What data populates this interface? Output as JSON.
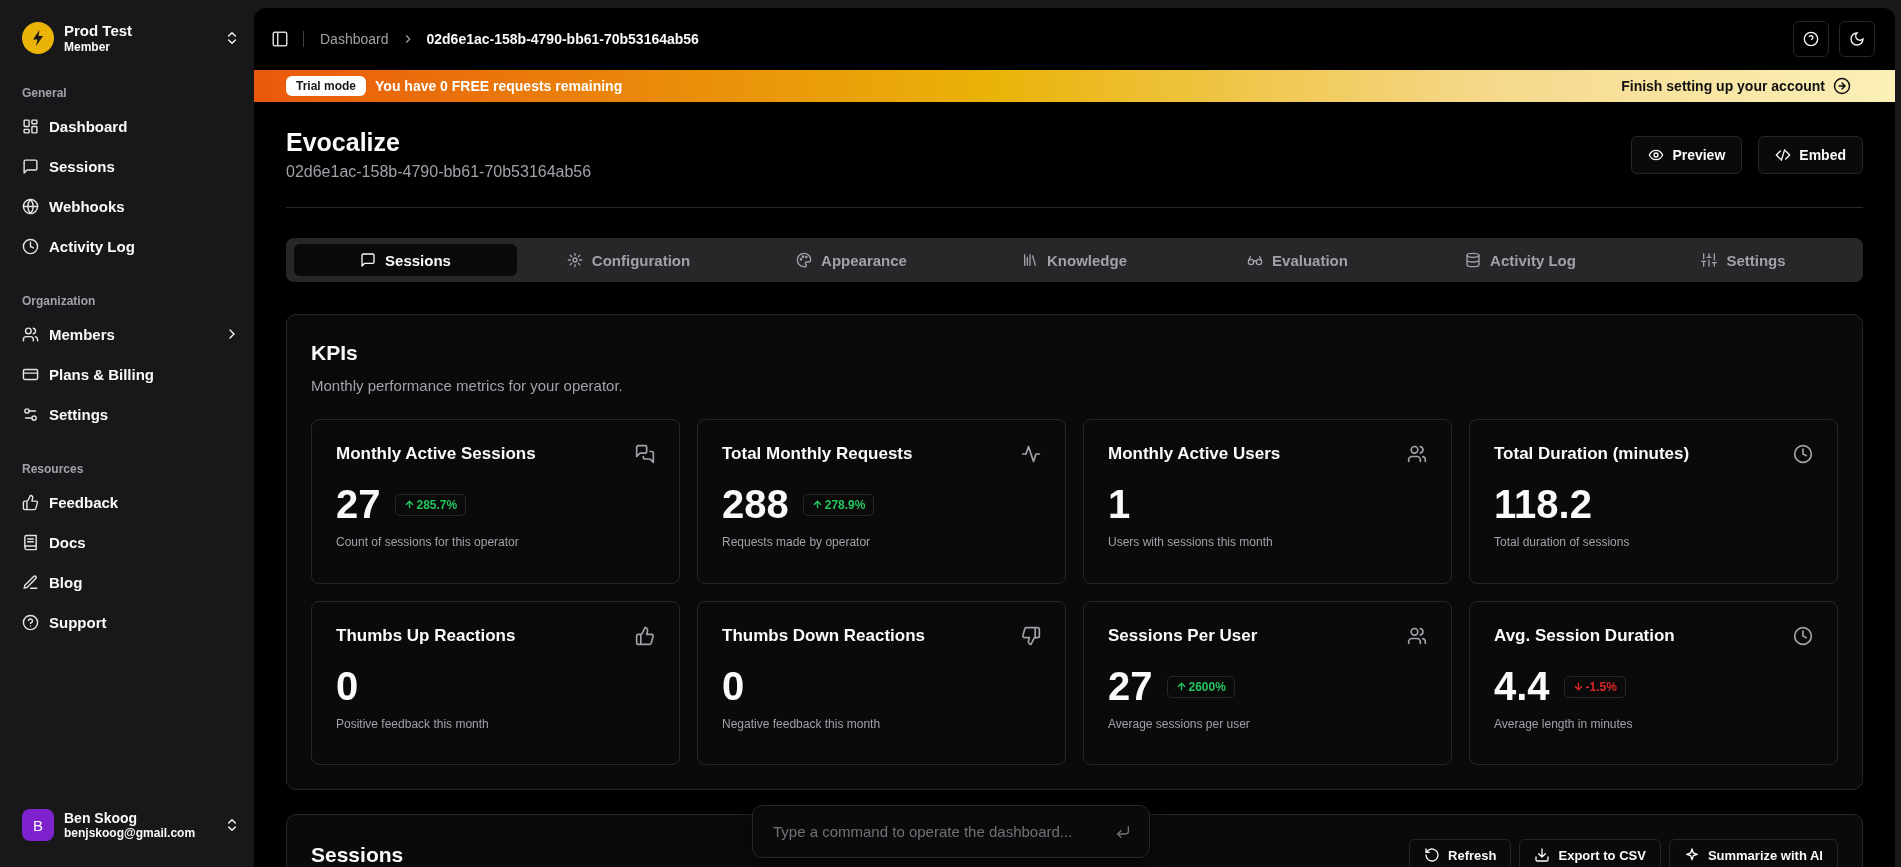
{
  "workspace": {
    "name": "Prod Test",
    "role": "Member"
  },
  "sidebar": {
    "groups": [
      {
        "label": "General",
        "items": [
          {
            "label": "Dashboard",
            "kind": "link"
          },
          {
            "label": "Sessions",
            "kind": "link"
          },
          {
            "label": "Webhooks",
            "kind": "link"
          },
          {
            "label": "Activity Log",
            "kind": "link"
          }
        ]
      },
      {
        "label": "Organization",
        "items": [
          {
            "label": "Members",
            "kind": "submenu"
          },
          {
            "label": "Plans & Billing",
            "kind": "link"
          },
          {
            "label": "Settings",
            "kind": "link"
          }
        ]
      },
      {
        "label": "Resources",
        "items": [
          {
            "label": "Feedback",
            "kind": "link"
          },
          {
            "label": "Docs",
            "kind": "link"
          },
          {
            "label": "Blog",
            "kind": "link"
          },
          {
            "label": "Support",
            "kind": "link"
          }
        ]
      }
    ]
  },
  "user": {
    "initial": "B",
    "name": "Ben Skoog",
    "email": "benjskoog@gmail.com"
  },
  "breadcrumb": [
    "Dashboard",
    "02d6e1ac-158b-4790-bb61-70b53164ab56"
  ],
  "banner": {
    "badge": "Trial mode",
    "message": "You have 0 FREE requests remaining",
    "action": "Finish setting up your account"
  },
  "operator": {
    "name": "Evocalize",
    "id": "02d6e1ac-158b-4790-bb61-70b53164ab56"
  },
  "header_buttons": [
    "Preview",
    "Embed"
  ],
  "tabs": [
    {
      "label": "Sessions",
      "selected": true
    },
    {
      "label": "Configuration",
      "selected": false
    },
    {
      "label": "Appearance",
      "selected": false
    },
    {
      "label": "Knowledge",
      "selected": false
    },
    {
      "label": "Evaluation",
      "selected": false
    },
    {
      "label": "Activity Log",
      "selected": false
    },
    {
      "label": "Settings",
      "selected": false
    }
  ],
  "kpis": {
    "title": "KPIs",
    "subtitle": "Monthly performance metrics for your operator.",
    "cards": [
      {
        "title": "Monthly Active Sessions",
        "value": "27",
        "delta": "285.7%",
        "negative": false,
        "description": "Count of sessions for this operator"
      },
      {
        "title": "Total Monthly Requests",
        "value": "288",
        "delta": "278.9%",
        "negative": false,
        "description": "Requests made by operator"
      },
      {
        "title": "Monthly Active Users",
        "value": "1",
        "description": "Users with sessions this month"
      },
      {
        "title": "Total Duration (minutes)",
        "value": "118.2",
        "description": "Total duration of sessions"
      },
      {
        "title": "Thumbs Up Reactions",
        "value": "0",
        "description": "Positive feedback this month"
      },
      {
        "title": "Thumbs Down Reactions",
        "value": "0",
        "description": "Negative feedback this month"
      },
      {
        "title": "Sessions Per User",
        "value": "27",
        "delta": "2600%",
        "negative": false,
        "description": "Average sessions per user"
      },
      {
        "title": "Avg. Session Duration",
        "value": "4.4",
        "delta": "-1.5%",
        "negative": true,
        "description": "Average length in minutes"
      }
    ]
  },
  "sessions": {
    "title": "Sessions",
    "buttons": [
      "Refresh",
      "Export to CSV",
      "Summarize with AI"
    ]
  },
  "command": {
    "placeholder": "Type a command to operate the dashboard..."
  }
}
